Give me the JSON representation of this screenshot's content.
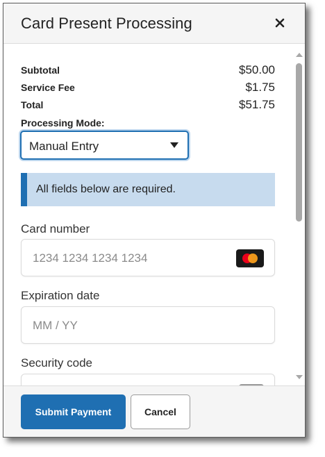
{
  "dialog": {
    "title": "Card Present Processing",
    "close_icon": "close-icon"
  },
  "summary": {
    "subtotal_label": "Subtotal",
    "subtotal_value": "$50.00",
    "fee_label": "Service Fee",
    "fee_value": "$1.75",
    "total_label": "Total",
    "total_value": "$51.75"
  },
  "processing_mode": {
    "label": "Processing Mode:",
    "selected": "Manual Entry",
    "arrow_icon": "caret-down-icon"
  },
  "notice": {
    "text": "All fields below are required."
  },
  "card_number": {
    "label": "Card number",
    "placeholder": "1234 1234 1234 1234",
    "brand_icon": "mastercard-icon"
  },
  "expiration": {
    "label": "Expiration date",
    "placeholder": "MM / YY"
  },
  "security_code": {
    "label": "Security code",
    "icon": "cvc-card-icon"
  },
  "footer": {
    "submit_label": "Submit Payment",
    "cancel_label": "Cancel"
  },
  "colors": {
    "primary": "#1f6fb2",
    "notice_bg": "#c7dbee",
    "mastercard_red": "#eb001b",
    "mastercard_orange": "#f79e1b"
  }
}
